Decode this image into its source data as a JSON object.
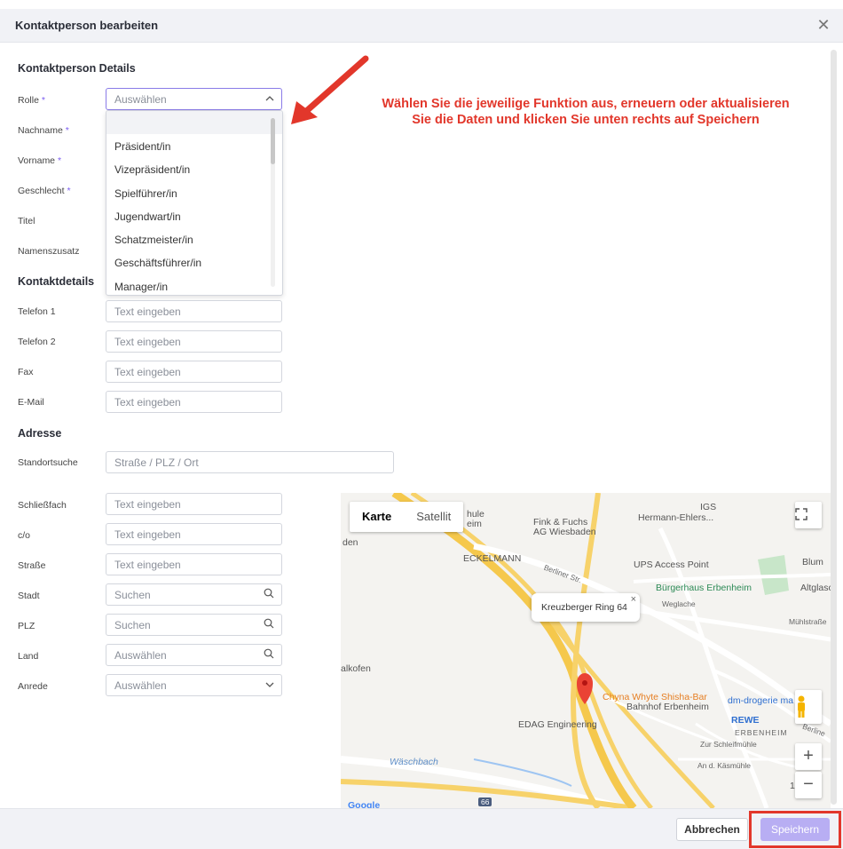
{
  "dialog": {
    "title": "Kontaktperson bearbeiten",
    "close_glyph": "✕"
  },
  "sections": {
    "details": "Kontaktperson Details",
    "contact": "Kontaktdetails",
    "address": "Adresse"
  },
  "required_mark": "*",
  "fields": {
    "rolle": {
      "label": "Rolle",
      "value": "Auswählen"
    },
    "nachname": {
      "label": "Nachname"
    },
    "vorname": {
      "label": "Vorname"
    },
    "geschlecht": {
      "label": "Geschlecht"
    },
    "titel": {
      "label": "Titel"
    },
    "namenszusatz": {
      "label": "Namenszusatz"
    },
    "telefon1": {
      "label": "Telefon 1",
      "placeholder": "Text eingeben"
    },
    "telefon2": {
      "label": "Telefon 2",
      "placeholder": "Text eingeben"
    },
    "fax": {
      "label": "Fax",
      "placeholder": "Text eingeben"
    },
    "email": {
      "label": "E-Mail",
      "placeholder": "Text eingeben"
    },
    "standortsuche": {
      "label": "Standortsuche",
      "placeholder": "Straße / PLZ / Ort"
    },
    "schliessfach": {
      "label": "Schließfach",
      "placeholder": "Text eingeben"
    },
    "co": {
      "label": "c/o",
      "placeholder": "Text eingeben"
    },
    "strasse": {
      "label": "Straße",
      "placeholder": "Text eingeben"
    },
    "stadt": {
      "label": "Stadt",
      "placeholder": "Suchen"
    },
    "plz": {
      "label": "PLZ",
      "placeholder": "Suchen"
    },
    "land": {
      "label": "Land",
      "placeholder": "Auswählen"
    },
    "anrede": {
      "label": "Anrede",
      "placeholder": "Auswählen"
    }
  },
  "role_options": [
    "Präsident/in",
    "Vizepräsident/in",
    "Spielführer/in",
    "Jugendwart/in",
    "Schatzmeister/in",
    "Geschäftsführer/in",
    "Manager/in"
  ],
  "annotation": {
    "line1": "Wählen Sie die jeweilige Funktion aus, erneuern oder aktualisieren",
    "line2": "Sie die Daten und klicken Sie unten rechts auf Speichern"
  },
  "map": {
    "type_map": "Karte",
    "type_satellite": "Satellit",
    "info_window": "Kreuzberger Ring 64",
    "labels": {
      "igs": "IGS",
      "hermann": "Hermann-Ehlers...",
      "fink1": "Fink & Fuchs",
      "fink2": "AG Wiesbaden",
      "schule1": "hule",
      "schule2": "eim",
      "den": "den",
      "eckelmann": "ECKELMANN",
      "berliner": "Berliner Str.",
      "ups": "UPS Access Point",
      "blum": "Blum",
      "buergerhaus": "Bürgerhaus Erbenheim",
      "altglas": "Altglasc",
      "weglache": "Weglache",
      "muehl": "Mühlstraße",
      "shisha": "Chyna Whyte Shisha-Bar",
      "alkofen": "alkofen",
      "erbenheim": "ERBENHEIM",
      "dm": "dm-drogerie ma",
      "bahnhof": "Bahnhof Erbenheim",
      "rewe": "REWE",
      "edag": "EDAG Engineering",
      "schleif": "Zur Schleifmühle",
      "kaesm": "An d. Käsmühle",
      "waeschbach": "Wäschbach",
      "berline": "Berline",
      "road66": "66",
      "google": "Google",
      "zoom_hint": "1"
    },
    "zoom_in": "+",
    "zoom_out": "−"
  },
  "footer": {
    "cancel": "Abbrechen",
    "save": "Speichern"
  },
  "colors": {
    "accent": "#8a7be8",
    "save_disabled": "#b8aef3",
    "annotation": "#e2372b"
  }
}
